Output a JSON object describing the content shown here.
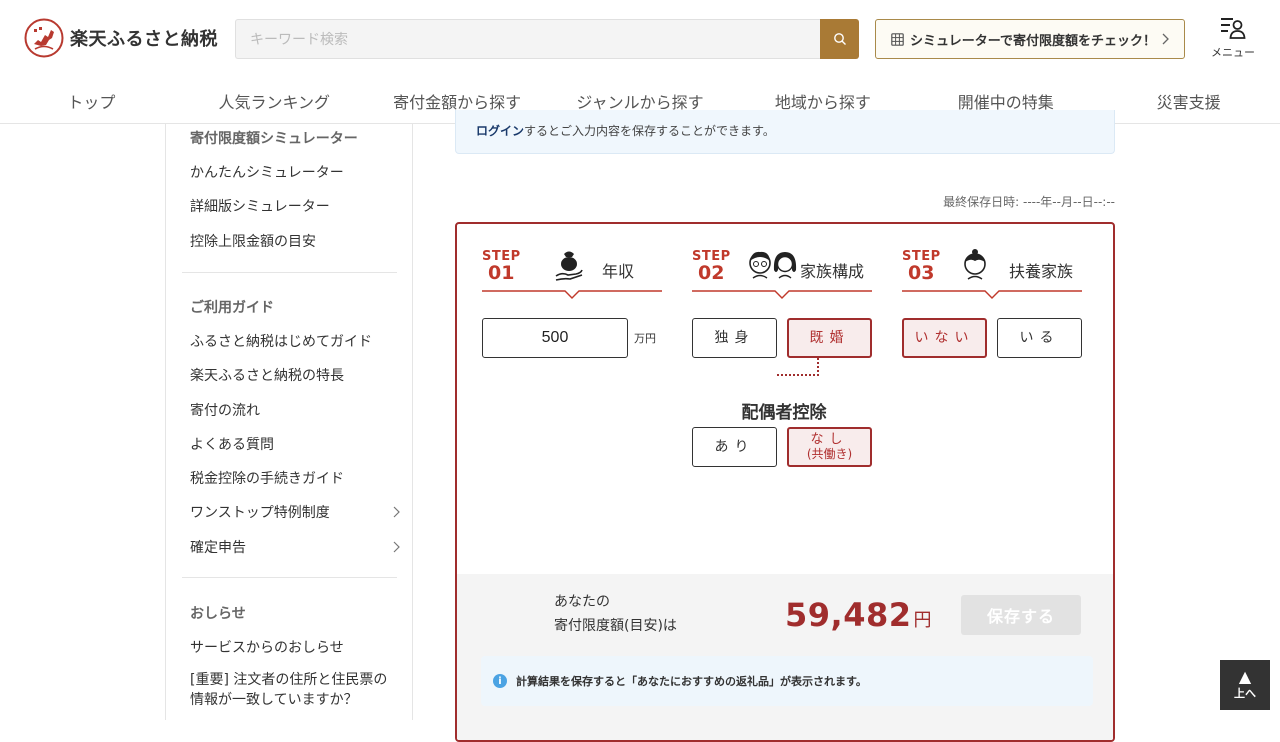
{
  "header": {
    "logo_text": "楽天ふるさと納税",
    "search_placeholder": "キーワード検索",
    "simulator_button": "シミュレーターで寄付限度額をチェック！",
    "menu_label": "メニュー"
  },
  "nav": [
    "トップ",
    "人気ランキング",
    "寄付金額から探す",
    "ジャンルから探す",
    "地域から探す",
    "開催中の特集",
    "災害支援"
  ],
  "sidebar": {
    "section1_title": "寄付限度額シミュレーター",
    "section1_items": [
      "かんたんシミュレーター",
      "詳細版シミュレーター",
      "控除上限金額の目安"
    ],
    "section2_title": "ご利用ガイド",
    "section2_items": [
      "ふるさと納税はじめてガイド",
      "楽天ふるさと納税の特長",
      "寄付の流れ",
      "よくある質問",
      "税金控除の手続きガイド",
      "ワンストップ特例制度",
      "確定申告"
    ],
    "section3_title": "おしらせ",
    "section3_items": [
      "サービスからのおしらせ",
      "[重要] 注文者の住所と住民票の情報が一致していますか？"
    ]
  },
  "login_banner": {
    "link": "ログイン",
    "text": "するとご入力内容を保存することができます。"
  },
  "last_saved": "最終保存日時: ----年--月--日--:--",
  "steps": [
    {
      "badge": "STEP",
      "num": "01",
      "title": "年収"
    },
    {
      "badge": "STEP",
      "num": "02",
      "title": "家族構成"
    },
    {
      "badge": "STEP",
      "num": "03",
      "title": "扶養家族"
    }
  ],
  "income": {
    "value": "500",
    "unit": "万円"
  },
  "family": {
    "single": "独身",
    "married": "既婚",
    "selected": "既婚"
  },
  "dependents": {
    "none": "いない",
    "yes": "いる",
    "selected": "いない"
  },
  "spouse": {
    "title": "配偶者控除",
    "yes": "あり",
    "no_line1": "なし",
    "no_line2": "(共働き)",
    "selected": "なし"
  },
  "result": {
    "label_line1": "あなたの",
    "label_line2": "寄付限度額(目安)は",
    "amount": "59,482",
    "yen": "円",
    "save_button": "保存する",
    "notice": "計算結果を保存すると「あなたにおすすめの返礼品」が表示されます。"
  },
  "to_top": "上へ",
  "colors": {
    "accent": "#a02d2d",
    "gold": "#a97a35",
    "info": "#4ba3e3"
  }
}
